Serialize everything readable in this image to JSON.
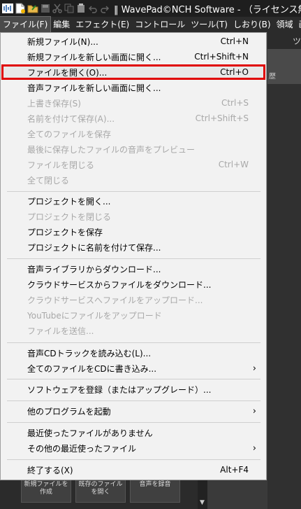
{
  "titlebar": {
    "title": "‖ WavePad©NCH Software - （ライセンス無",
    "icons": [
      "waveform-icon",
      "new-file-icon",
      "open-folder-icon",
      "save-icon",
      "cut-icon",
      "copy-icon",
      "paste-icon",
      "undo-icon",
      "redo-icon"
    ]
  },
  "menubar": [
    "ファイル(F)",
    "編集",
    "エフェクト(E)",
    "コントロール",
    "ツール(T)",
    "しおり(B)",
    "領域",
    "画面"
  ],
  "right_fragment": {
    "tab_text": "ツ",
    "toolbar_text": "歴"
  },
  "bottom_buttons": [
    "新規ファイルを作成",
    "既存のファイルを開く",
    "音声を録音"
  ],
  "file_menu": {
    "items": [
      {
        "label": "新規ファイル(N)...",
        "shortcut": "Ctrl+N",
        "disabled": false
      },
      {
        "label": "新規ファイルを新しい画面に開く...",
        "shortcut": "Ctrl+Shift+N",
        "disabled": false
      },
      {
        "label": "ファイルを開く(O)...",
        "shortcut": "Ctrl+O",
        "disabled": false,
        "highlight": true
      },
      {
        "label": "音声ファイルを新しい画面に開く...",
        "shortcut": "",
        "disabled": false
      },
      {
        "label": "上書き保存(S)",
        "shortcut": "Ctrl+S",
        "disabled": true
      },
      {
        "label": "名前を付けて保存(A)...",
        "shortcut": "Ctrl+Shift+S",
        "disabled": true
      },
      {
        "label": "全てのファイルを保存",
        "shortcut": "",
        "disabled": true
      },
      {
        "label": "最後に保存したファイルの音声をプレビュー",
        "shortcut": "",
        "disabled": true
      },
      {
        "label": "ファイルを閉じる",
        "shortcut": "Ctrl+W",
        "disabled": true
      },
      {
        "label": "全て閉じる",
        "shortcut": "",
        "disabled": true
      },
      {
        "label": "プロジェクトを開く...",
        "shortcut": "",
        "disabled": false
      },
      {
        "label": "プロジェクトを閉じる",
        "shortcut": "",
        "disabled": true
      },
      {
        "label": "プロジェクトを保存",
        "shortcut": "",
        "disabled": false
      },
      {
        "label": "プロジェクトに名前を付けて保存...",
        "shortcut": "",
        "disabled": false
      },
      {
        "label": "音声ライブラリからダウンロード...",
        "shortcut": "",
        "disabled": false
      },
      {
        "label": "クラウドサービスからファイルをダウンロード...",
        "shortcut": "",
        "disabled": false
      },
      {
        "label": "クラウドサービスへファイルをアップロード...",
        "shortcut": "",
        "disabled": true
      },
      {
        "label": "YouTubeにファイルをアップロード",
        "shortcut": "",
        "disabled": true
      },
      {
        "label": "ファイルを送信...",
        "shortcut": "",
        "disabled": true
      },
      {
        "label": "音声CDトラックを読み込む(L)...",
        "shortcut": "",
        "disabled": false
      },
      {
        "label": "全てのファイルをCDに書き込み...",
        "shortcut": "",
        "disabled": false,
        "submenu": true
      },
      {
        "label": "ソフトウェアを登録（またはアップグレード）...",
        "shortcut": "",
        "disabled": false
      },
      {
        "label": "他のプログラムを起動",
        "shortcut": "",
        "disabled": false,
        "submenu": true
      },
      {
        "label": "最近使ったファイルがありません",
        "shortcut": "",
        "disabled": false
      },
      {
        "label": "その他の最近使ったファイル",
        "shortcut": "",
        "disabled": false,
        "submenu": true
      },
      {
        "label": "終了する(X)",
        "shortcut": "Alt+F4",
        "disabled": false
      }
    ]
  }
}
